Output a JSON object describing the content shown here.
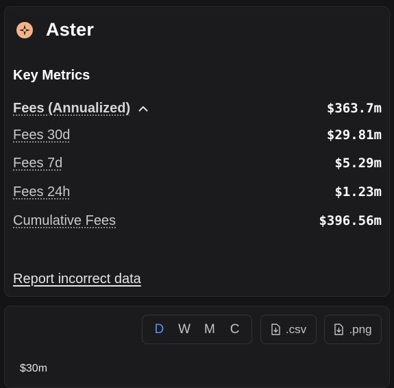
{
  "header": {
    "title": "Aster",
    "logo_icon": "aster-logo-icon"
  },
  "key_metrics": {
    "title": "Key Metrics",
    "items": [
      {
        "label": "Fees (Annualized)",
        "value": "$363.7m",
        "expanded": true
      },
      {
        "label": "Fees 30d",
        "value": "$29.81m"
      },
      {
        "label": "Fees 7d",
        "value": "$5.29m"
      },
      {
        "label": "Fees 24h",
        "value": "$1.23m"
      },
      {
        "label": "Cumulative Fees",
        "value": "$396.56m"
      }
    ]
  },
  "report_link": "Report incorrect data",
  "chart": {
    "periods": [
      "D",
      "W",
      "M",
      "C"
    ],
    "active_period": "D",
    "csv_label": ".csv",
    "png_label": ".png",
    "y_axis_top_label": "$30m"
  },
  "colors": {
    "accent": "#5a8df5",
    "logo": "#f4b48a",
    "background": "#141416",
    "card": "#1b1b1e"
  }
}
